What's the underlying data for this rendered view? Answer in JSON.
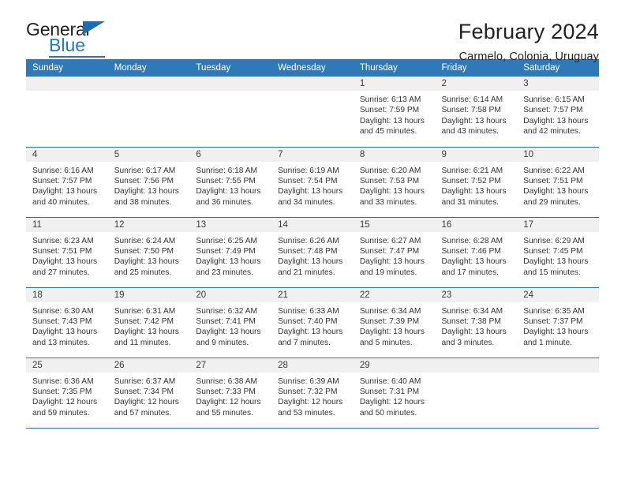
{
  "brand": {
    "name_part1": "General",
    "name_part2": "Blue",
    "accent_color": "#2277c8",
    "triangle_icon": "blue-triangle-icon"
  },
  "header": {
    "title": "February 2024",
    "subtitle": "Carmelo, Colonia, Uruguay"
  },
  "calendar": {
    "header_bg": "#3079b8",
    "row_divider_color": "#2f6fad",
    "daynum_bg": "#f0f0f0",
    "weekday_headers": [
      "Sunday",
      "Monday",
      "Tuesday",
      "Wednesday",
      "Thursday",
      "Friday",
      "Saturday"
    ],
    "weeks": [
      [
        {
          "day": "",
          "lines": []
        },
        {
          "day": "",
          "lines": []
        },
        {
          "day": "",
          "lines": []
        },
        {
          "day": "",
          "lines": []
        },
        {
          "day": "1",
          "lines": [
            "Sunrise: 6:13 AM",
            "Sunset: 7:59 PM",
            "Daylight: 13 hours",
            "and 45 minutes."
          ]
        },
        {
          "day": "2",
          "lines": [
            "Sunrise: 6:14 AM",
            "Sunset: 7:58 PM",
            "Daylight: 13 hours",
            "and 43 minutes."
          ]
        },
        {
          "day": "3",
          "lines": [
            "Sunrise: 6:15 AM",
            "Sunset: 7:57 PM",
            "Daylight: 13 hours",
            "and 42 minutes."
          ]
        }
      ],
      [
        {
          "day": "4",
          "lines": [
            "Sunrise: 6:16 AM",
            "Sunset: 7:57 PM",
            "Daylight: 13 hours",
            "and 40 minutes."
          ]
        },
        {
          "day": "5",
          "lines": [
            "Sunrise: 6:17 AM",
            "Sunset: 7:56 PM",
            "Daylight: 13 hours",
            "and 38 minutes."
          ]
        },
        {
          "day": "6",
          "lines": [
            "Sunrise: 6:18 AM",
            "Sunset: 7:55 PM",
            "Daylight: 13 hours",
            "and 36 minutes."
          ]
        },
        {
          "day": "7",
          "lines": [
            "Sunrise: 6:19 AM",
            "Sunset: 7:54 PM",
            "Daylight: 13 hours",
            "and 34 minutes."
          ]
        },
        {
          "day": "8",
          "lines": [
            "Sunrise: 6:20 AM",
            "Sunset: 7:53 PM",
            "Daylight: 13 hours",
            "and 33 minutes."
          ]
        },
        {
          "day": "9",
          "lines": [
            "Sunrise: 6:21 AM",
            "Sunset: 7:52 PM",
            "Daylight: 13 hours",
            "and 31 minutes."
          ]
        },
        {
          "day": "10",
          "lines": [
            "Sunrise: 6:22 AM",
            "Sunset: 7:51 PM",
            "Daylight: 13 hours",
            "and 29 minutes."
          ]
        }
      ],
      [
        {
          "day": "11",
          "lines": [
            "Sunrise: 6:23 AM",
            "Sunset: 7:51 PM",
            "Daylight: 13 hours",
            "and 27 minutes."
          ]
        },
        {
          "day": "12",
          "lines": [
            "Sunrise: 6:24 AM",
            "Sunset: 7:50 PM",
            "Daylight: 13 hours",
            "and 25 minutes."
          ]
        },
        {
          "day": "13",
          "lines": [
            "Sunrise: 6:25 AM",
            "Sunset: 7:49 PM",
            "Daylight: 13 hours",
            "and 23 minutes."
          ]
        },
        {
          "day": "14",
          "lines": [
            "Sunrise: 6:26 AM",
            "Sunset: 7:48 PM",
            "Daylight: 13 hours",
            "and 21 minutes."
          ]
        },
        {
          "day": "15",
          "lines": [
            "Sunrise: 6:27 AM",
            "Sunset: 7:47 PM",
            "Daylight: 13 hours",
            "and 19 minutes."
          ]
        },
        {
          "day": "16",
          "lines": [
            "Sunrise: 6:28 AM",
            "Sunset: 7:46 PM",
            "Daylight: 13 hours",
            "and 17 minutes."
          ]
        },
        {
          "day": "17",
          "lines": [
            "Sunrise: 6:29 AM",
            "Sunset: 7:45 PM",
            "Daylight: 13 hours",
            "and 15 minutes."
          ]
        }
      ],
      [
        {
          "day": "18",
          "lines": [
            "Sunrise: 6:30 AM",
            "Sunset: 7:43 PM",
            "Daylight: 13 hours",
            "and 13 minutes."
          ]
        },
        {
          "day": "19",
          "lines": [
            "Sunrise: 6:31 AM",
            "Sunset: 7:42 PM",
            "Daylight: 13 hours",
            "and 11 minutes."
          ]
        },
        {
          "day": "20",
          "lines": [
            "Sunrise: 6:32 AM",
            "Sunset: 7:41 PM",
            "Daylight: 13 hours",
            "and 9 minutes."
          ]
        },
        {
          "day": "21",
          "lines": [
            "Sunrise: 6:33 AM",
            "Sunset: 7:40 PM",
            "Daylight: 13 hours",
            "and 7 minutes."
          ]
        },
        {
          "day": "22",
          "lines": [
            "Sunrise: 6:34 AM",
            "Sunset: 7:39 PM",
            "Daylight: 13 hours",
            "and 5 minutes."
          ]
        },
        {
          "day": "23",
          "lines": [
            "Sunrise: 6:34 AM",
            "Sunset: 7:38 PM",
            "Daylight: 13 hours",
            "and 3 minutes."
          ]
        },
        {
          "day": "24",
          "lines": [
            "Sunrise: 6:35 AM",
            "Sunset: 7:37 PM",
            "Daylight: 13 hours",
            "and 1 minute."
          ]
        }
      ],
      [
        {
          "day": "25",
          "lines": [
            "Sunrise: 6:36 AM",
            "Sunset: 7:35 PM",
            "Daylight: 12 hours",
            "and 59 minutes."
          ]
        },
        {
          "day": "26",
          "lines": [
            "Sunrise: 6:37 AM",
            "Sunset: 7:34 PM",
            "Daylight: 12 hours",
            "and 57 minutes."
          ]
        },
        {
          "day": "27",
          "lines": [
            "Sunrise: 6:38 AM",
            "Sunset: 7:33 PM",
            "Daylight: 12 hours",
            "and 55 minutes."
          ]
        },
        {
          "day": "28",
          "lines": [
            "Sunrise: 6:39 AM",
            "Sunset: 7:32 PM",
            "Daylight: 12 hours",
            "and 53 minutes."
          ]
        },
        {
          "day": "29",
          "lines": [
            "Sunrise: 6:40 AM",
            "Sunset: 7:31 PM",
            "Daylight: 12 hours",
            "and 50 minutes."
          ]
        },
        {
          "day": "",
          "lines": []
        },
        {
          "day": "",
          "lines": []
        }
      ]
    ]
  }
}
